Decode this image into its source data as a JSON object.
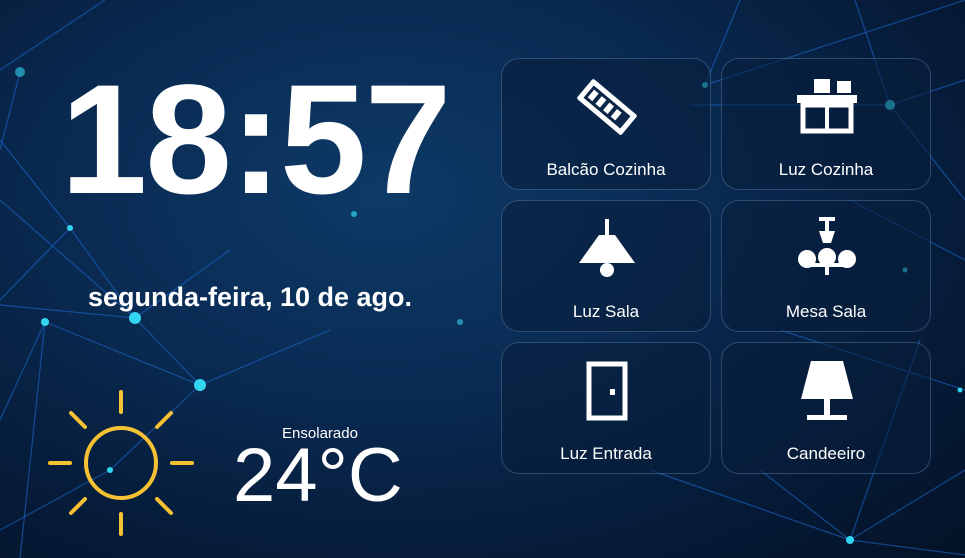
{
  "clock": {
    "time": "18:57",
    "date": "segunda-feira, 10 de ago."
  },
  "weather": {
    "condition": "Ensolarado",
    "temperature": "24°C",
    "icon": "sun-icon",
    "icon_color": "#f6c233"
  },
  "tiles": [
    {
      "label": "Balcão Cozinha",
      "icon": "led-strip-icon"
    },
    {
      "label": "Luz Cozinha",
      "icon": "kitchen-light-icon"
    },
    {
      "label": "Luz Sala",
      "icon": "ceiling-lamp-icon"
    },
    {
      "label": "Mesa Sala",
      "icon": "chandelier-icon"
    },
    {
      "label": "Luz Entrada",
      "icon": "door-icon"
    },
    {
      "label": "Candeeiro",
      "icon": "floor-lamp-icon"
    }
  ],
  "colors": {
    "background": "#0a2c55",
    "network_lines": "#1e6fd9",
    "nodes": "#33d6f0",
    "text": "#ffffff"
  }
}
